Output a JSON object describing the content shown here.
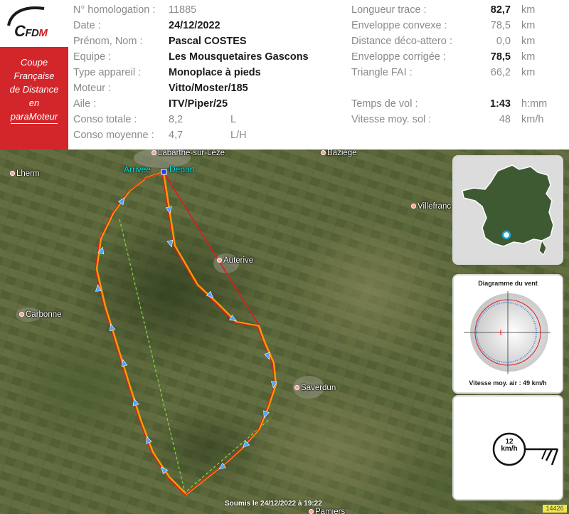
{
  "logo": {
    "text_c": "C",
    "text_fd": "FD",
    "text_m": "M"
  },
  "cup_title": [
    "Coupe",
    "Française",
    "de Distance",
    "en",
    "paraMoteur"
  ],
  "info": [
    {
      "label": "N° homologation :",
      "value": "11885",
      "unit": "",
      "bold": false
    },
    {
      "label": "Date :",
      "value": "24/12/2022",
      "unit": "",
      "bold": true
    },
    {
      "label": "Prénom, Nom :",
      "value": "Pascal COSTES",
      "unit": "",
      "bold": true
    },
    {
      "label": "Equipe :",
      "value": "Les Mousquetaires Gascons",
      "unit": "",
      "bold": true
    },
    {
      "label": "Type appareil :",
      "value": "Monoplace à pieds",
      "unit": "",
      "bold": true
    },
    {
      "label": "Moteur :",
      "value": "Vitto/Moster/185",
      "unit": "",
      "bold": true
    },
    {
      "label": "Aile :",
      "value": "ITV/Piper/25",
      "unit": "",
      "bold": true
    },
    {
      "label": "Conso totale :",
      "value": "8,2",
      "unit": "L",
      "bold": false
    },
    {
      "label": "Conso moyenne :",
      "value": "4,7",
      "unit": "L/H",
      "bold": false
    }
  ],
  "stats": [
    {
      "label": "Longueur trace :",
      "value": "82,7",
      "unit": "km",
      "bold": true
    },
    {
      "label": "Enveloppe convexe :",
      "value": "78,5",
      "unit": "km",
      "bold": false
    },
    {
      "label": "Distance déco-attero :",
      "value": "0,0",
      "unit": "km",
      "bold": false
    },
    {
      "label": "Enveloppe corrigée :",
      "value": "78,5",
      "unit": "km",
      "bold": true
    },
    {
      "label": "Triangle FAI :",
      "value": "66,2",
      "unit": "km",
      "bold": false
    },
    {
      "label": "Temps de vol :",
      "value": "1:43",
      "unit": "h:mm",
      "bold": true
    },
    {
      "label": "Vitesse moy. sol :",
      "value": "48",
      "unit": "km/h",
      "bold": false
    }
  ],
  "map": {
    "towns": [
      "Labarthe-sur-Lèze",
      "Baziège",
      "Lherm",
      "Villefranc",
      "Auterive",
      "Carbonne",
      "Saverdun",
      "Pamiers"
    ],
    "arrival_label": "Arrivée",
    "departure_label": "Départ",
    "submitted": "Soumis le 24/12/2022 à 19:22",
    "flight_id": "14426"
  },
  "wind": {
    "title": "Diagramme du vent",
    "air_speed": "Vitesse moy. air : 49 km/h",
    "wind_speed_value": "12",
    "wind_speed_unit": "km/h"
  },
  "colors": {
    "cup_red": "#d3262b",
    "track_red": "#e21a1a",
    "track_orange": "#ff9900",
    "fai_green": "#7ddc3c",
    "cyan": "#00e5e5"
  }
}
